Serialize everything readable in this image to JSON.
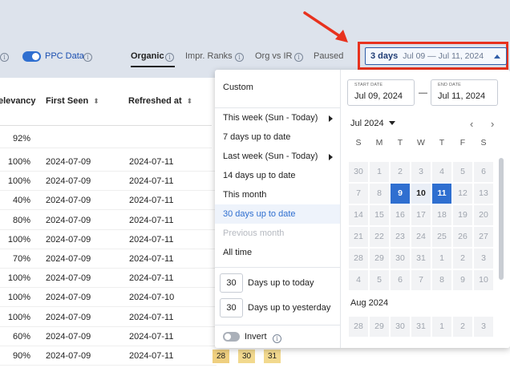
{
  "header": {
    "ppc_label": "PPC Data",
    "tabs": [
      "Organic",
      "Impr. Ranks",
      "Org vs IR",
      "Paused"
    ],
    "info_glyph": "i",
    "date_button": {
      "days": "3 days",
      "range": "Jul 09 — Jul 11, 2024"
    }
  },
  "table": {
    "columns": {
      "relevancy": "elevancy",
      "first_seen": "First Seen",
      "refreshed_at": "Refreshed at"
    },
    "summary_relevancy": "92%",
    "rows": [
      {
        "relevancy": "100%",
        "first_seen": "2024-07-09",
        "refreshed_at": "2024-07-11"
      },
      {
        "relevancy": "100%",
        "first_seen": "2024-07-09",
        "refreshed_at": "2024-07-11"
      },
      {
        "relevancy": "40%",
        "first_seen": "2024-07-09",
        "refreshed_at": "2024-07-11"
      },
      {
        "relevancy": "80%",
        "first_seen": "2024-07-09",
        "refreshed_at": "2024-07-11"
      },
      {
        "relevancy": "100%",
        "first_seen": "2024-07-09",
        "refreshed_at": "2024-07-11"
      },
      {
        "relevancy": "70%",
        "first_seen": "2024-07-09",
        "refreshed_at": "2024-07-11"
      },
      {
        "relevancy": "100%",
        "first_seen": "2024-07-09",
        "refreshed_at": "2024-07-11"
      },
      {
        "relevancy": "100%",
        "first_seen": "2024-07-09",
        "refreshed_at": "2024-07-10"
      },
      {
        "relevancy": "100%",
        "first_seen": "2024-07-09",
        "refreshed_at": "2024-07-11"
      },
      {
        "relevancy": "60%",
        "first_seen": "2024-07-09",
        "refreshed_at": "2024-07-11"
      },
      {
        "relevancy": "90%",
        "first_seen": "2024-07-09",
        "refreshed_at": "2024-07-11"
      }
    ],
    "heat_values": [
      "28",
      "30",
      "31"
    ]
  },
  "date_picker": {
    "menu": {
      "custom": "Custom",
      "this_week": "This week (Sun - Today)",
      "seven_days": "7 days up to date",
      "last_week": "Last week (Sun - Today)",
      "fourteen_days": "14 days up to date",
      "this_month": "This month",
      "thirty_days": "30 days up to date",
      "previous_month": "Previous month",
      "all_time": "All time",
      "days_up_to_today_value": "30",
      "days_up_to_today_label": "Days up to today",
      "days_up_to_yesterday_value": "30",
      "days_up_to_yesterday_label": "Days up to yesterday",
      "invert": "Invert"
    },
    "start_label": "START DATE",
    "start_value": "Jul 09, 2024",
    "end_label": "END DATE",
    "end_value": "Jul 11, 2024",
    "dash": "—",
    "month1": "Jul 2024",
    "month2": "Aug 2024",
    "weekdays": [
      "S",
      "M",
      "T",
      "W",
      "T",
      "F",
      "S"
    ],
    "jul_weeks": [
      [
        "30",
        "1",
        "2",
        "3",
        "4",
        "5",
        "6"
      ],
      [
        "7",
        "8",
        "9",
        "10",
        "11",
        "12",
        "13"
      ],
      [
        "14",
        "15",
        "16",
        "17",
        "18",
        "19",
        "20"
      ],
      [
        "21",
        "22",
        "23",
        "24",
        "25",
        "26",
        "27"
      ],
      [
        "28",
        "29",
        "30",
        "31",
        "1",
        "2",
        "3"
      ],
      [
        "4",
        "5",
        "6",
        "7",
        "8",
        "9",
        "10"
      ]
    ],
    "aug_weeks": [
      [
        "28",
        "29",
        "30",
        "31",
        "1",
        "2",
        "3"
      ]
    ],
    "selected_days": [
      "9",
      "11"
    ],
    "range_days": [
      "10"
    ],
    "nav_prev": "‹",
    "nav_next": "›"
  },
  "colors": {
    "accent": "#2f6fd0",
    "highlight_outline": "#e8321e",
    "topbar_bg": "#dde3ec",
    "heat_green": "#dfe7b2",
    "heat_yellow": "#f2d98e",
    "heat_orange": "#efcf7f"
  },
  "icons": [
    "info-icon",
    "sort-icon",
    "caret-up-icon",
    "caret-down-icon",
    "chevron-left-icon",
    "chevron-right-icon",
    "submenu-arrow-icon",
    "red-arrow-annotation"
  ]
}
